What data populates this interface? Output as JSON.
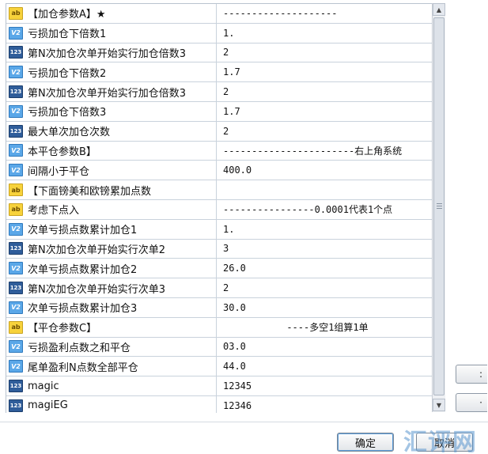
{
  "params": [
    {
      "icon": "ab",
      "name": "【加仓参数A】★",
      "value": "--------------------",
      "align": "left"
    },
    {
      "icon": "v2",
      "name": "亏损加仓下倍数1",
      "value": "1.",
      "align": "left"
    },
    {
      "icon": "123",
      "name": "第N次加仓次单开始实行加仓倍数3",
      "value": "2",
      "align": "left"
    },
    {
      "icon": "v2",
      "name": "亏损加仓下倍数2",
      "value": "1.7",
      "align": "left"
    },
    {
      "icon": "123",
      "name": "第N次加仓次单开始实行加仓倍数3",
      "value": "2",
      "align": "left"
    },
    {
      "icon": "v2",
      "name": "亏损加仓下倍数3",
      "value": "1.7",
      "align": "left"
    },
    {
      "icon": "123",
      "name": "最大单次加仓次数",
      "value": "2",
      "align": "left"
    },
    {
      "icon": "v2",
      "name": "本平仓参数B】",
      "value": "-----------------------右上角系统",
      "align": "left"
    },
    {
      "icon": "v2",
      "name": "间隔小于平仓",
      "value": "400.0",
      "align": "left"
    },
    {
      "icon": "ab",
      "name": "【下面镑美和欧镑累加点数",
      "value": "",
      "align": "left"
    },
    {
      "icon": "ab",
      "name": "考虑下点入",
      "value": "----------------0.0001代表1个点",
      "align": "left"
    },
    {
      "icon": "v2",
      "name": "次单亏损点数累计加仓1",
      "value": "1.",
      "align": "left"
    },
    {
      "icon": "123",
      "name": "第N次加仓次单开始实行次单2",
      "value": "3",
      "align": "left"
    },
    {
      "icon": "v2",
      "name": "次单亏损点数累计加仓2",
      "value": "26.0",
      "align": "left"
    },
    {
      "icon": "123",
      "name": "第N次加仓次单开始实行次单3",
      "value": "2",
      "align": "left"
    },
    {
      "icon": "v2",
      "name": "次单亏损点数累计加仓3",
      "value": "30.0",
      "align": "left"
    },
    {
      "icon": "ab",
      "name": "【平仓参数C】",
      "value": "----多空1组算1单",
      "align": "center"
    },
    {
      "icon": "v2",
      "name": "亏损盈利点数之和平仓",
      "value": "03.0",
      "align": "left"
    },
    {
      "icon": "v2",
      "name": "尾单盈利N点数全部平仓",
      "value": "44.0",
      "align": "left"
    },
    {
      "icon": "123",
      "name": "magic",
      "value": "12345",
      "align": "left"
    },
    {
      "icon": "123",
      "name": "magiEG",
      "value": "12346",
      "align": "left"
    }
  ],
  "icon_labels": {
    "ab": "ab",
    "v2": "V2",
    "123": "123"
  },
  "scrollbar": {
    "grip_glyph": "≡",
    "up_glyph": "▲",
    "down_glyph": "▼"
  },
  "side_buttons": [
    {
      "label": ":"
    },
    {
      "label": "·"
    }
  ],
  "dialog": {
    "ok_label": "确定",
    "cancel_label": "取消"
  },
  "watermark": "汇评网",
  "colors": {
    "ab_icon": "#f7d23b",
    "v2_icon": "#5aa7e8",
    "n123_icon": "#2f5d9a"
  }
}
